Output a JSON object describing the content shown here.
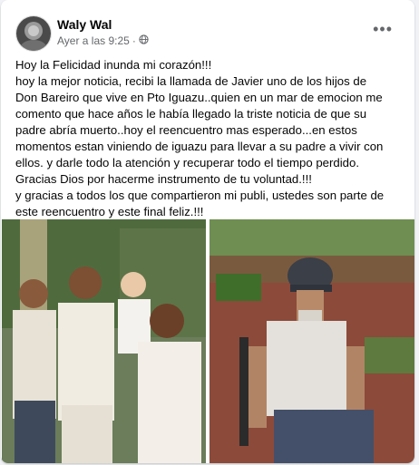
{
  "post": {
    "author": "Waly Wal",
    "timestamp": "Ayer a las 9:25",
    "separator": "·",
    "audience_icon": "globe-icon",
    "more_label": "•••",
    "lines": [
      "Hoy la Felicidad inunda mi corazón!!!",
      "hoy la mejor noticia, recibi la llamada de Javier uno de los hijos de",
      "Don Bareiro que vive en Pto Iguazu..quien en un mar de emocion me",
      "comento que hace años le había llegado la triste noticia de que su",
      "padre abría muerto..hoy el reencuentro mas esperado...en estos",
      "momentos estan viniendo de iguazu para llevar a su padre a vivir con",
      "ellos. y darle todo la atención y recuperar todo el tiempo perdido.",
      "Gracias Dios por hacerme instrumento de tu voluntad.!!!",
      "y gracias a todos los que compartieron mi publi, ustedes son parte de",
      "este reencuentro y este final feliz.!!!"
    ]
  }
}
